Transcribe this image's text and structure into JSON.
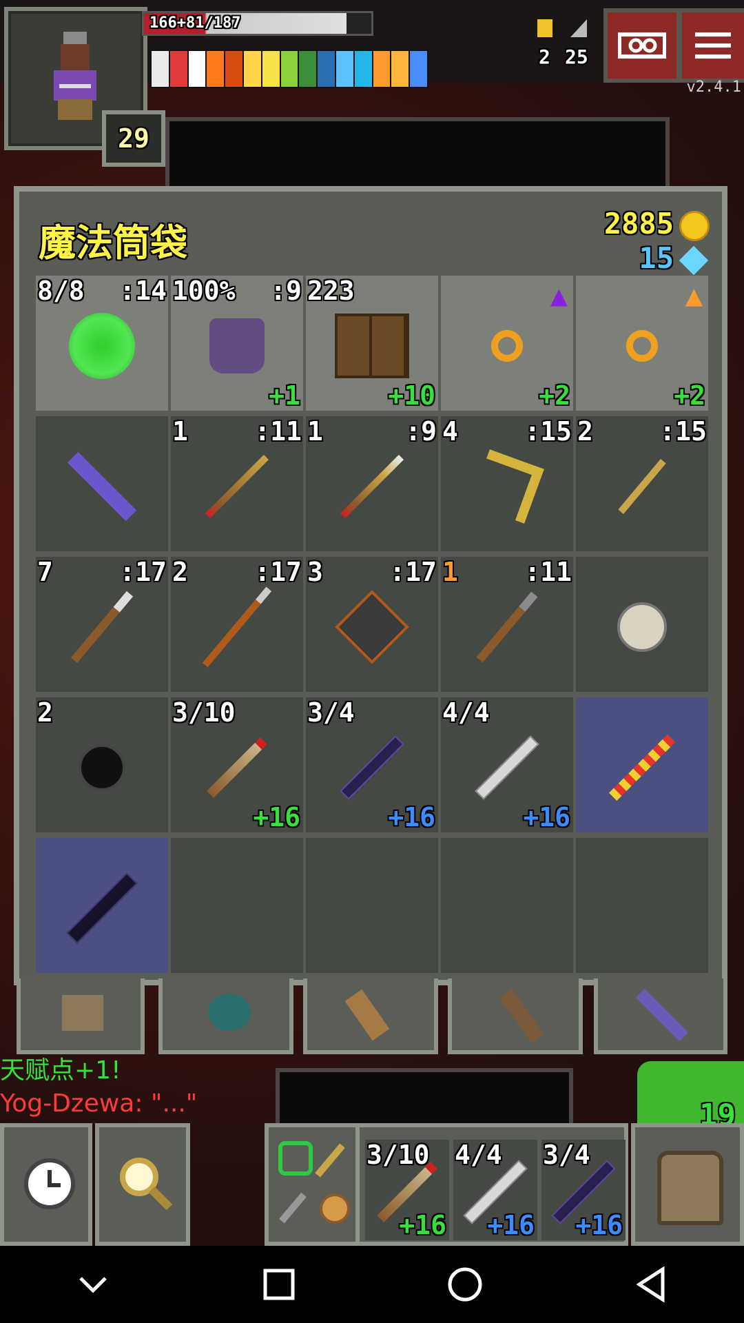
{
  "status": {
    "hp_text": "166+81/187",
    "hp_fraction": 0.89,
    "level": "29",
    "version": "v2.4.1",
    "challenges": "2",
    "depth": "25",
    "buff_colors": [
      "#eaeaea",
      "#e23b3b",
      "#ffffff",
      "#ff7a1a",
      "#d94d12",
      "#ffd34a",
      "#f7e24a",
      "#8bd13c",
      "#3b8f3b",
      "#2a6fb0",
      "#5bc1ff",
      "#24b6e8",
      "#ff9a2e",
      "#ffb43b",
      "#4a8cff"
    ]
  },
  "colors": {
    "title": "#fff34a",
    "gold": "#fff34a",
    "gems": "#58c7ff",
    "upgrade_green": "#37e03a",
    "upgrade_blue": "#3b8cff",
    "selected_slot": "#4c5080"
  },
  "bag": {
    "title": "魔法筒袋",
    "gold": "2885",
    "gems": "15",
    "slots": [
      {
        "tl": "8/8",
        "tr": ":14",
        "br": "",
        "icon": "green-seed-pod-icon",
        "style": "lite"
      },
      {
        "tl": "100%",
        "tr": ":9",
        "br": "+1",
        "br_color": "green",
        "icon": "purple-armor-icon",
        "style": "lite"
      },
      {
        "tl": "223",
        "tr": "",
        "br": "+10",
        "br_color": "green",
        "icon": "alchemy-cabinet-icon",
        "style": "lite"
      },
      {
        "tl": "",
        "tr": "",
        "br": "+2",
        "br_color": "green",
        "icon": "orange-ring-icon",
        "up": "purple-upgrade-arrow-icon",
        "style": "lite"
      },
      {
        "tl": "",
        "tr": "",
        "br": "+2",
        "br_color": "green",
        "icon": "orange-ring-icon",
        "up": "orange-upgrade-arrow-icon",
        "style": "lite"
      },
      {
        "tl": "",
        "tr": "",
        "br": "",
        "icon": "purple-wand-icon",
        "style": ""
      },
      {
        "tl": "1",
        "tr": ":11",
        "br": "",
        "icon": "fire-dart-icon",
        "style": ""
      },
      {
        "tl": "1",
        "tr": ":9",
        "br": "",
        "icon": "poison-dart-icon",
        "style": ""
      },
      {
        "tl": "4",
        "tr": ":15",
        "br": "",
        "icon": "boomerang-icon",
        "style": ""
      },
      {
        "tl": "2",
        "tr": ":15",
        "br": "",
        "icon": "throwing-axe-icon",
        "style": ""
      },
      {
        "tl": "7",
        "tr": ":17",
        "br": "",
        "icon": "throwing-hammer-icon",
        "style": ""
      },
      {
        "tl": "2",
        "tr": ":17",
        "br": "",
        "icon": "trident-icon",
        "style": ""
      },
      {
        "tl": "3",
        "tr": ":17",
        "br": "",
        "icon": "iron-cube-icon",
        "style": ""
      },
      {
        "tl": "1",
        "tl_color": "orange",
        "tr": ":11",
        "br": "",
        "icon": "war-hammer-icon",
        "style": ""
      },
      {
        "tl": "",
        "tr": "",
        "br": "",
        "icon": "flashbang-bomb-icon",
        "style": ""
      },
      {
        "tl": "2",
        "tr": "",
        "br": "",
        "icon": "black-bomb-icon",
        "style": ""
      },
      {
        "tl": "3/10",
        "tr": "",
        "br": "+16",
        "br_color": "green",
        "icon": "wooden-wand-icon",
        "style": ""
      },
      {
        "tl": "3/4",
        "tr": "",
        "br": "+16",
        "br_color": "blue",
        "icon": "dark-wand-icon",
        "style": ""
      },
      {
        "tl": "4/4",
        "tr": "",
        "br": "+16",
        "br_color": "blue",
        "icon": "silver-wand-icon",
        "style": ""
      },
      {
        "tl": "",
        "tr": "",
        "br": "",
        "icon": "candy-staff-icon",
        "style": "sel"
      },
      {
        "tl": "",
        "tr": "",
        "br": "",
        "icon": "obsidian-staff-icon",
        "style": "sel"
      },
      {
        "tl": "",
        "tr": "",
        "br": "",
        "icon": "",
        "style": ""
      },
      {
        "tl": "",
        "tr": "",
        "br": "",
        "icon": "",
        "style": ""
      },
      {
        "tl": "",
        "tr": "",
        "br": "",
        "icon": "",
        "style": ""
      },
      {
        "tl": "",
        "tr": "",
        "br": "",
        "icon": "",
        "style": ""
      }
    ]
  },
  "tabs": [
    "backpack-tab",
    "seed-pouch-tab",
    "scroll-holder-tab",
    "potion-bandolier-tab",
    "wand-holster-tab"
  ],
  "log": [
    {
      "text": "天赋点+1!",
      "color": "#37e03a"
    },
    {
      "text": "Yog-Dzewa: \"...\"",
      "color": "#ff3a3a"
    }
  ],
  "hud": {
    "search_count": "19"
  },
  "quickslots": [
    {
      "tl": "3/10",
      "br": "+16",
      "br_color": "green",
      "icon": "wooden-wand-icon"
    },
    {
      "tl": "4/4",
      "br": "+16",
      "br_color": "blue",
      "icon": "silver-wand-icon"
    },
    {
      "tl": "3/4",
      "br": "+16",
      "br_color": "blue",
      "icon": "dark-wand-icon"
    }
  ]
}
